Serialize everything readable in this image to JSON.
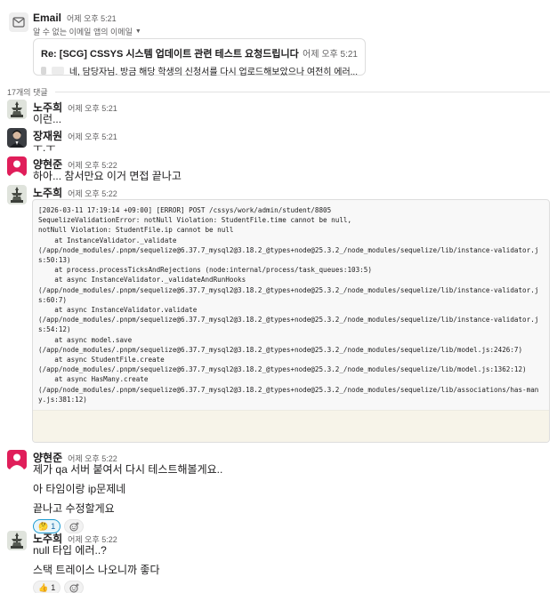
{
  "email": {
    "sender": "Email",
    "time": "어제 오후 5:21",
    "sub": "알 수 없는 이메일 앱의 이메일",
    "subject": "Re: [SCG] CSSYS 시스템 업데이트 관련 테스트 요청드립니다",
    "subject_time": "어제 오후 5:21",
    "preview": "네, 담당자님. 방금 해당 학생의 신청서를 다시 업로드해보았으나 여전히 에러..."
  },
  "thread": {
    "reply_count": "17개의 댓글"
  },
  "messages": [
    {
      "name": "노주희",
      "time": "어제 오후 5:21",
      "text": "이런..."
    },
    {
      "name": "장재원",
      "time": "어제 오후 5:21",
      "text": "ㅜ.ㅜ"
    },
    {
      "name": "양현준",
      "time": "어제 오후 5:22",
      "text": "하아... 참서만요 이거 면접 끝나고"
    },
    {
      "name": "노주희",
      "time": "어제 오후 5:22",
      "code": "[2026-03-11 17:19:14 +09:00] [ERROR] POST /cssys/work/admin/student/8805\nSequelizeValidationError: notNull Violation: StudentFile.time cannot be null,\nnotNull Violation: StudentFile.ip cannot be null\n    at InstanceValidator._validate\n(/app/node_modules/.pnpm/sequelize@6.37.7_mysql2@3.18.2_@types+node@25.3.2_/node_modules/sequelize/lib/instance-validator.js:50:13)\n    at process.processTicksAndRejections (node:internal/process/task_queues:103:5)\n    at async InstanceValidator._validateAndRunHooks\n(/app/node_modules/.pnpm/sequelize@6.37.7_mysql2@3.18.2_@types+node@25.3.2_/node_modules/sequelize/lib/instance-validator.js:60:7)\n    at async InstanceValidator.validate\n(/app/node_modules/.pnpm/sequelize@6.37.7_mysql2@3.18.2_@types+node@25.3.2_/node_modules/sequelize/lib/instance-validator.js:54:12)\n    at async model.save\n(/app/node_modules/.pnpm/sequelize@6.37.7_mysql2@3.18.2_@types+node@25.3.2_/node_modules/sequelize/lib/model.js:2426:7)\n    at async StudentFile.create\n(/app/node_modules/.pnpm/sequelize@6.37.7_mysql2@3.18.2_@types+node@25.3.2_/node_modules/sequelize/lib/model.js:1362:12)\n    at async HasMany.create\n(/app/node_modules/.pnpm/sequelize@6.37.7_mysql2@3.18.2_@types+node@25.3.2_/node_modules/sequelize/lib/associations/has-many.js:381:12)"
    },
    {
      "name": "양현준",
      "time": "어제 오후 5:22",
      "lines": [
        "제가 qa 서버 붙여서 다시 테스트해볼게요..",
        "아 타임이랑 ip문제네",
        "끝나고 수정할게요"
      ],
      "reaction": {
        "emoji": "thinking-face",
        "count": "1"
      }
    },
    {
      "name": "노주희",
      "time": "어제 오후 5:22",
      "lines": [
        "null 타입 에러..?",
        "스택 트레이스 나오니까 좋다"
      ],
      "reaction": {
        "emoji": "thumbs-up",
        "count": "1"
      }
    }
  ],
  "colors": {
    "accent": "#1d9bd1",
    "avatar_pink": "#e01e5a"
  }
}
